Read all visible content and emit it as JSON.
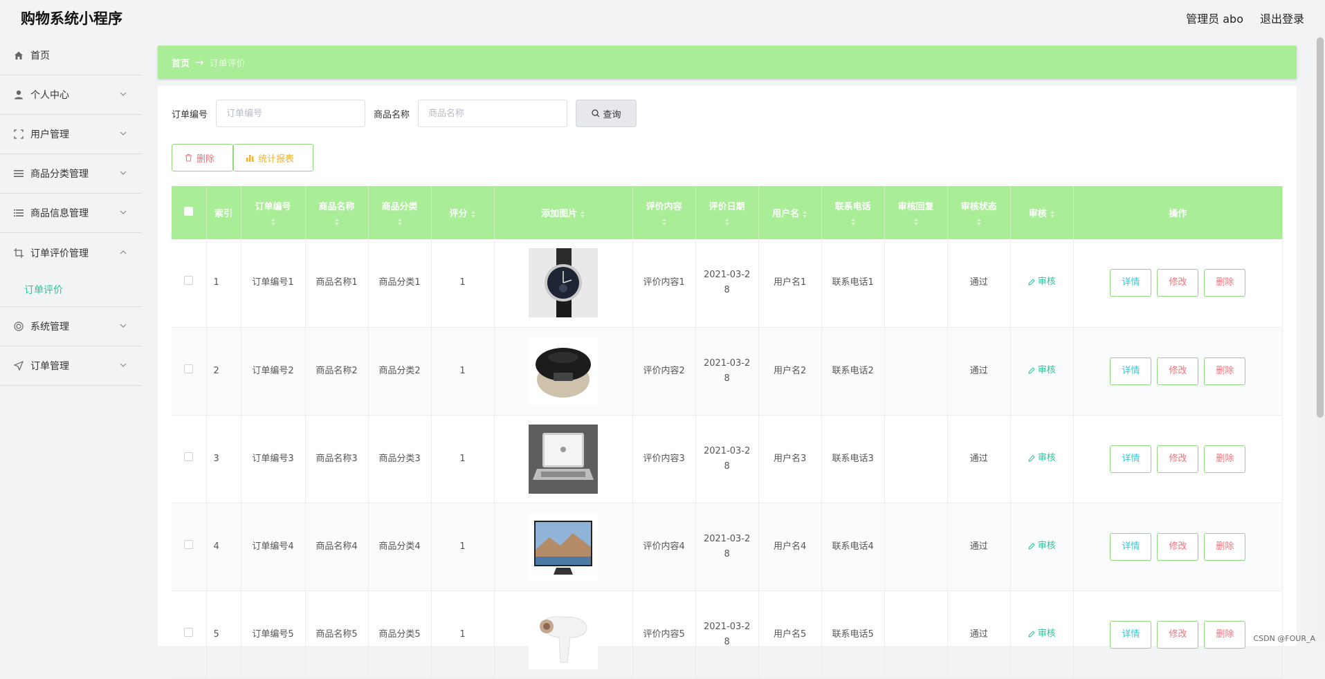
{
  "header": {
    "app_title": "购物系统小程序",
    "admin_label": "管理员 abo",
    "logout_label": "退出登录"
  },
  "sidebar": {
    "items": [
      {
        "label": "首页",
        "icon": "home-icon"
      },
      {
        "label": "个人中心",
        "icon": "user-icon"
      },
      {
        "label": "用户管理",
        "icon": "frame-icon"
      },
      {
        "label": "商品分类管理",
        "icon": "list-icon"
      },
      {
        "label": "商品信息管理",
        "icon": "list-icon"
      },
      {
        "label": "订单评价管理",
        "icon": "crop-icon"
      },
      {
        "label": "系统管理",
        "icon": "settings-icon"
      },
      {
        "label": "订单管理",
        "icon": "send-icon"
      }
    ],
    "submenu_active": "订单评价"
  },
  "breadcrumb": {
    "home": "首页",
    "current": "订单评价"
  },
  "search": {
    "order_no_label": "订单编号",
    "order_no_placeholder": "订单编号",
    "goods_name_label": "商品名称",
    "goods_name_placeholder": "商品名称",
    "query_label": "查询"
  },
  "actions": {
    "delete_label": "删除",
    "stats_label": "统计报表"
  },
  "table": {
    "headers": [
      "索引",
      "订单编号",
      "商品名称",
      "商品分类",
      "评分",
      "添加图片",
      "评价内容",
      "评价日期",
      "用户名",
      "联系电话",
      "审核回复",
      "审核状态",
      "审核",
      "操作"
    ],
    "rows": [
      {
        "index": "1",
        "order_no": "订单编号1",
        "goods_name": "商品名称1",
        "category": "商品分类1",
        "score": "1",
        "image": "watch",
        "content": "评价内容1",
        "date_a": "2021-03-2",
        "date_b": "8",
        "username": "用户名1",
        "phone": "联系电话1",
        "reply": "",
        "status": "通过",
        "audit": "审核"
      },
      {
        "index": "2",
        "order_no": "订单编号2",
        "goods_name": "商品名称2",
        "category": "商品分类2",
        "score": "1",
        "image": "rice-cooker",
        "content": "评价内容2",
        "date_a": "2021-03-2",
        "date_b": "8",
        "username": "用户名2",
        "phone": "联系电话2",
        "reply": "",
        "status": "通过",
        "audit": "审核"
      },
      {
        "index": "3",
        "order_no": "订单编号3",
        "goods_name": "商品名称3",
        "category": "商品分类3",
        "score": "1",
        "image": "laptop",
        "content": "评价内容3",
        "date_a": "2021-03-2",
        "date_b": "8",
        "username": "用户名3",
        "phone": "联系电话3",
        "reply": "",
        "status": "通过",
        "audit": "审核"
      },
      {
        "index": "4",
        "order_no": "订单编号4",
        "goods_name": "商品名称4",
        "category": "商品分类4",
        "score": "1",
        "image": "tv",
        "content": "评价内容4",
        "date_a": "2021-03-2",
        "date_b": "8",
        "username": "用户名4",
        "phone": "联系电话4",
        "reply": "",
        "status": "通过",
        "audit": "审核"
      },
      {
        "index": "5",
        "order_no": "订单编号5",
        "goods_name": "商品名称5",
        "category": "商品分类5",
        "score": "1",
        "image": "hair-dryer",
        "content": "评价内容5",
        "date_a": "2021-03-2",
        "date_b": "8",
        "username": "用户名5",
        "phone": "联系电话5",
        "reply": "",
        "status": "通过",
        "audit": "审核"
      }
    ],
    "ops": {
      "detail": "详情",
      "edit": "修改",
      "delete": "删除"
    }
  },
  "watermark": "CSDN @FOUR_A",
  "colors": {
    "accent_green": "#a9ed97",
    "active_text": "#2bc49b",
    "danger": "#f5707a",
    "warning": "#f0b33a",
    "info": "#3cc6d4"
  }
}
